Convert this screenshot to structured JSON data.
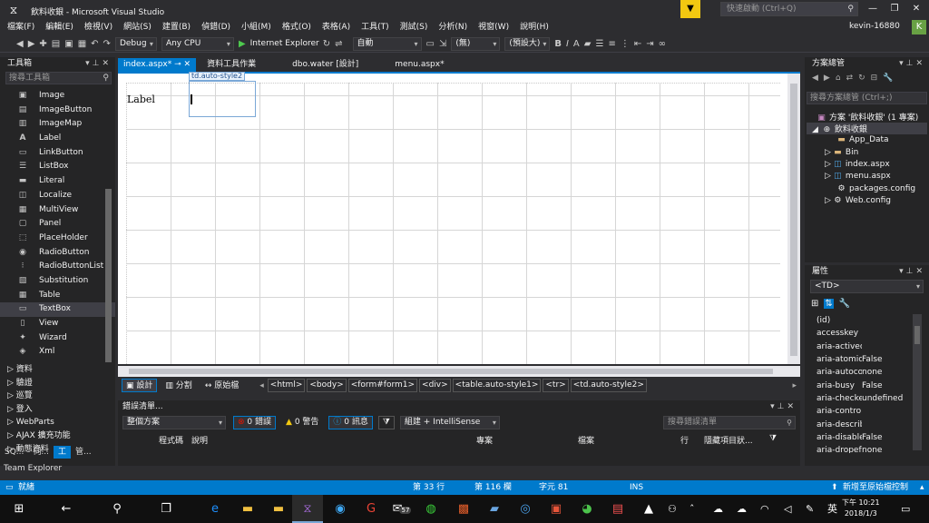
{
  "window": {
    "title": "飲料收銀 - Microsoft Visual Studio",
    "quick_launch_placeholder": "快速啟動 (Ctrl+Q)",
    "user": "kevin-16880",
    "avatar_letter": "K"
  },
  "menu": [
    "檔案(F)",
    "編輯(E)",
    "檢視(V)",
    "網站(S)",
    "建置(B)",
    "偵錯(D)",
    "小組(M)",
    "格式(O)",
    "表格(A)",
    "工具(T)",
    "測試(S)",
    "分析(N)",
    "視窗(W)",
    "說明(H)"
  ],
  "toolbar": {
    "config": "Debug",
    "platform": "Any CPU",
    "run_target": "Internet Explorer",
    "auto": "自動",
    "style": "(無)",
    "font": "(預設大)",
    "bold": "B",
    "italic": "I"
  },
  "toolbox": {
    "title": "工具箱",
    "search_placeholder": "搜尋工具箱",
    "items": [
      {
        "label": "Image",
        "icon": "image-icon"
      },
      {
        "label": "ImageButton",
        "icon": "image-button-icon"
      },
      {
        "label": "ImageMap",
        "icon": "image-map-icon"
      },
      {
        "label": "Label",
        "icon": "label-icon"
      },
      {
        "label": "LinkButton",
        "icon": "link-button-icon"
      },
      {
        "label": "ListBox",
        "icon": "list-box-icon"
      },
      {
        "label": "Literal",
        "icon": "literal-icon"
      },
      {
        "label": "Localize",
        "icon": "localize-icon"
      },
      {
        "label": "MultiView",
        "icon": "multiview-icon"
      },
      {
        "label": "Panel",
        "icon": "panel-icon"
      },
      {
        "label": "PlaceHolder",
        "icon": "placeholder-icon"
      },
      {
        "label": "RadioButton",
        "icon": "radio-button-icon"
      },
      {
        "label": "RadioButtonList",
        "icon": "radio-button-list-icon"
      },
      {
        "label": "Substitution",
        "icon": "substitution-icon"
      },
      {
        "label": "Table",
        "icon": "table-icon"
      },
      {
        "label": "TextBox",
        "icon": "textbox-icon",
        "selected": true
      },
      {
        "label": "View",
        "icon": "view-icon"
      },
      {
        "label": "Wizard",
        "icon": "wizard-icon"
      },
      {
        "label": "Xml",
        "icon": "xml-icon"
      }
    ],
    "categories": [
      "▷ 資料",
      "▷ 驗證",
      "▷ 巡覽",
      "▷ 登入",
      "▷ WebParts",
      "▷ AJAX 擴充功能",
      "▷ 動態資料"
    ],
    "bottom_tabs": [
      "SQ...",
      "伺...",
      "工",
      "管..."
    ],
    "team_explorer": "Team Explorer"
  },
  "doc_tabs": [
    {
      "label": "index.aspx*",
      "active": true
    },
    {
      "label": "資料工具作業",
      "active": false
    },
    {
      "label": "dbo.water [設計]",
      "active": false
    },
    {
      "label": "menu.aspx*",
      "active": false
    }
  ],
  "designer": {
    "label_control": "Label",
    "td_tag": "td.auto-style2"
  },
  "viewbar": {
    "views": [
      "設計",
      "分割",
      "原始檔"
    ],
    "crumbs": [
      "<html>",
      "<body>",
      "<form#form1>",
      "<div>",
      "<table.auto-style1>",
      "<tr>",
      "<td.auto-style2>"
    ]
  },
  "error_list": {
    "title": "錯誤清單...",
    "scope": "整個方案",
    "errors": "0 錯誤",
    "warnings": "0 警告",
    "messages": "0 訊息",
    "build_filter": "組建 + IntelliSense",
    "search_placeholder": "搜尋錯誤清單",
    "columns": [
      "程式碼",
      "說明",
      "專案",
      "檔案",
      "行",
      "隱藏項目狀..."
    ]
  },
  "solution": {
    "title": "方案總管",
    "search_placeholder": "搜尋方案總管 (Ctrl+;)",
    "solution_label": "方案 '飲料收銀' (1 專案)",
    "project": "飲料收銀",
    "items": [
      "App_Data",
      "Bin",
      "index.aspx",
      "menu.aspx",
      "packages.config",
      "Web.config"
    ]
  },
  "properties": {
    "title": "屬性",
    "object": "<TD>",
    "rows": [
      {
        "name": "(id)",
        "value": ""
      },
      {
        "name": "accesskey",
        "value": ""
      },
      {
        "name": "aria-activec",
        "value": ""
      },
      {
        "name": "aria-atomic",
        "value": "False"
      },
      {
        "name": "aria-autoco",
        "value": "none"
      },
      {
        "name": "aria-busy",
        "value": "False"
      },
      {
        "name": "aria-checke",
        "value": "undefined"
      },
      {
        "name": "aria-contro",
        "value": ""
      },
      {
        "name": "aria-describ",
        "value": ""
      },
      {
        "name": "aria-disable",
        "value": "False"
      },
      {
        "name": "aria-dropef",
        "value": "none"
      }
    ]
  },
  "status": {
    "ready": "就緒",
    "line": "第 33 行",
    "col": "第 116 欄",
    "char": "字元 81",
    "mode": "INS",
    "source_control": "新增至原始檔控制"
  },
  "taskbar": {
    "badge": "57",
    "ime": "英",
    "time": "下午 10:21",
    "date": "2018/1/3"
  }
}
